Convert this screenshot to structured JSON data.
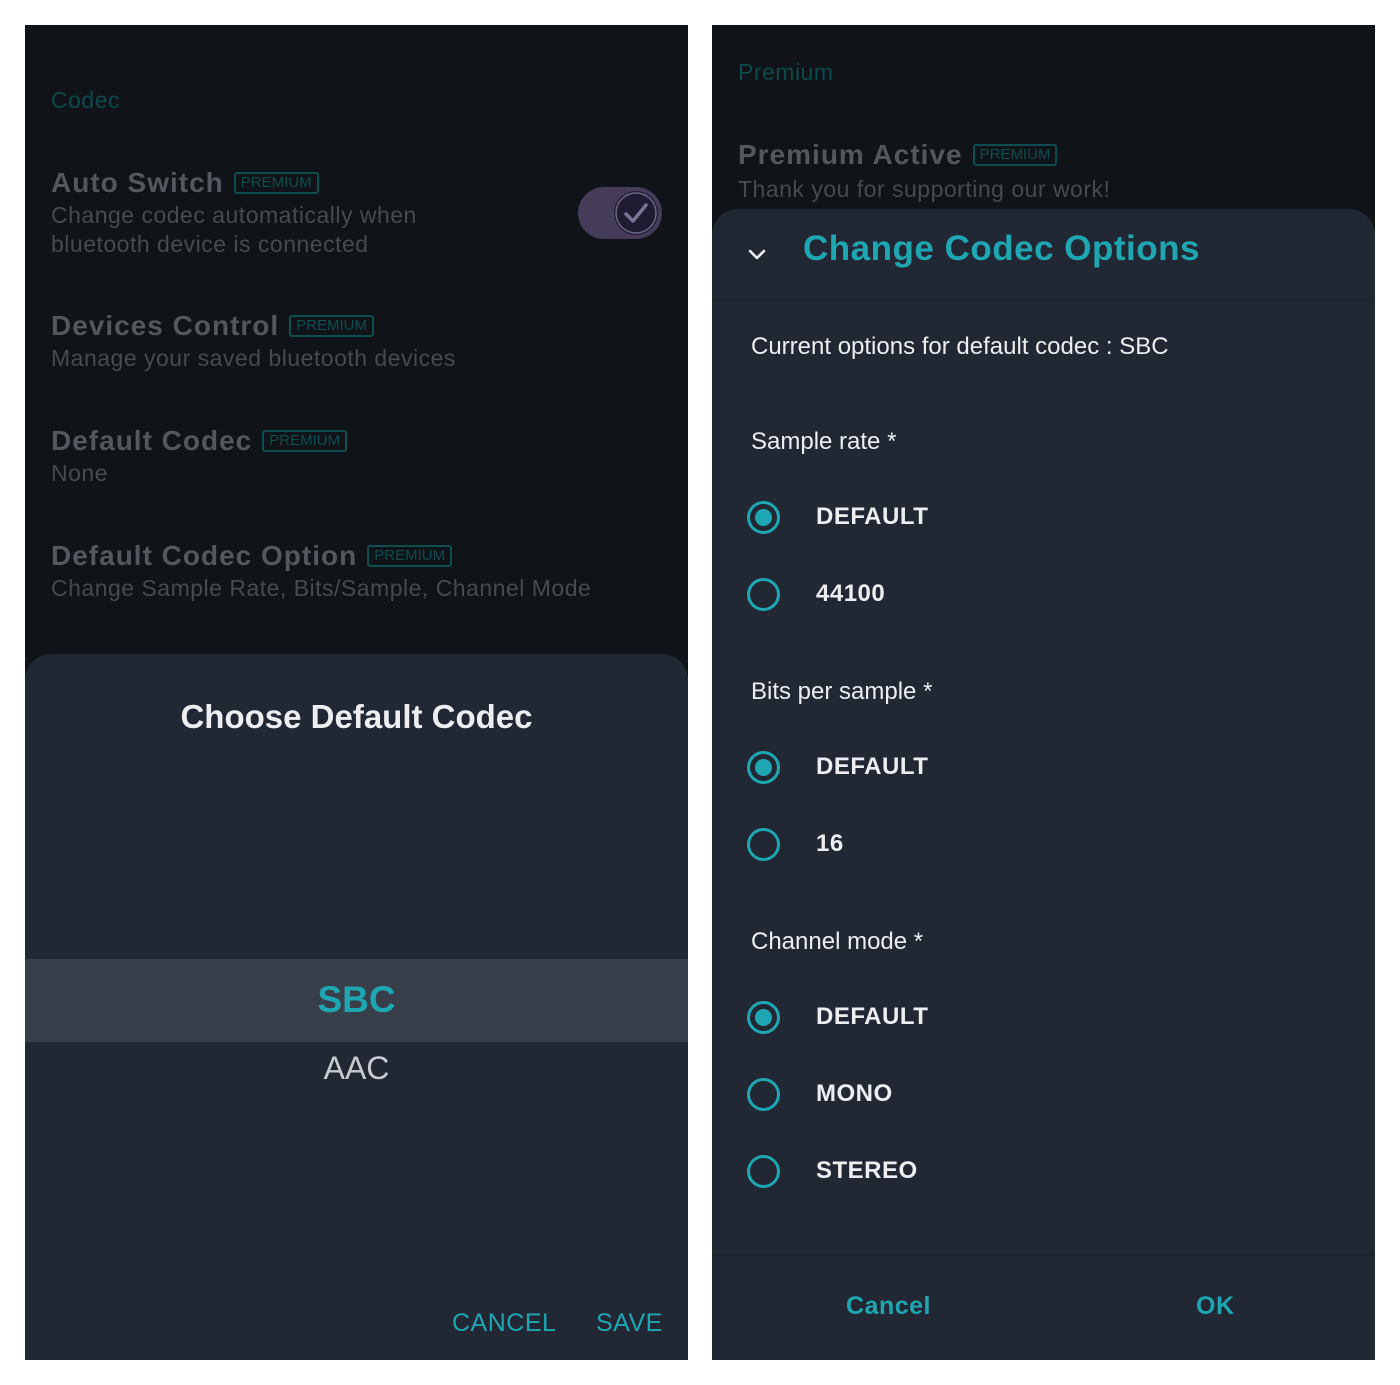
{
  "left": {
    "section_header": "Codec",
    "prefs": [
      {
        "title": "Auto Switch",
        "badge": "PREMIUM",
        "subtitle": "Change codec automatically when bluetooth device is connected"
      },
      {
        "title": "Devices Control",
        "badge": "PREMIUM",
        "subtitle": "Manage your saved bluetooth devices"
      },
      {
        "title": "Default Codec",
        "badge": "PREMIUM",
        "subtitle": "None"
      },
      {
        "title": "Default Codec Option",
        "badge": "PREMIUM",
        "subtitle": "Change Sample Rate, Bits/Sample, Channel Mode"
      }
    ],
    "auto_switch_enabled": true,
    "sheet": {
      "title": "Choose Default Codec",
      "options": [
        "SBC",
        "AAC"
      ],
      "selected": "SBC",
      "cancel_label": "CANCEL",
      "save_label": "SAVE"
    }
  },
  "right": {
    "section_header": "Premium",
    "premium_title": "Premium Active",
    "premium_badge": "PREMIUM",
    "premium_subtitle": "Thank you for supporting our work!",
    "dialog": {
      "title": "Change Codec Options",
      "current_text": "Current options for default codec : SBC",
      "groups": [
        {
          "label": "Sample rate *",
          "options": [
            "DEFAULT",
            "44100"
          ],
          "selected": "DEFAULT"
        },
        {
          "label": "Bits per sample *",
          "options": [
            "DEFAULT",
            "16"
          ],
          "selected": "DEFAULT"
        },
        {
          "label": "Channel mode *",
          "options": [
            "DEFAULT",
            "MONO",
            "STEREO"
          ],
          "selected": "DEFAULT"
        }
      ],
      "cancel_label": "Cancel",
      "ok_label": "OK"
    }
  },
  "colors": {
    "accent": "#1ea7b2",
    "sheet_bg": "#212834",
    "screen_bg": "#101317"
  },
  "icons": [
    "checkmark-icon",
    "chevron-down-icon"
  ]
}
